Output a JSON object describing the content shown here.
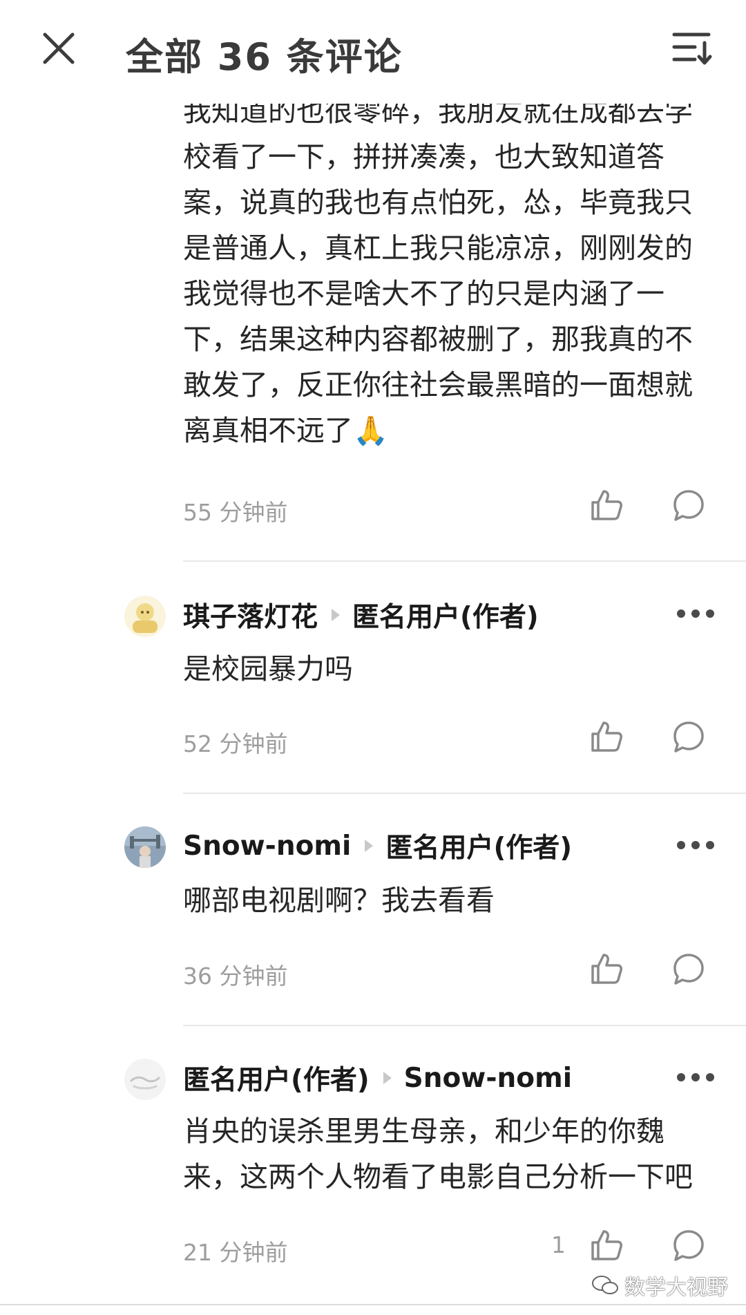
{
  "header": {
    "title": "全部 36 条评论",
    "close_icon": "close-icon",
    "sort_icon": "sort-icon"
  },
  "comments": [
    {
      "body_lines": [
        "我知道的也很零碎，我朋友就在成都去学",
        "校看了一下，拼拼凑凑，也大致知道答",
        "案，说真的我也有点怕死，怂，毕竟我只",
        "是普通人，真杠上我只能凉凉，刚刚发的",
        "我觉得也不是啥大不了的只是内涵了一",
        "下，结果这种内容都被删了，那我真的不",
        "敢发了，反正你往社会最黑暗的一面想就",
        "离真相不远了🙏"
      ],
      "time": "55 分钟前"
    },
    {
      "author": "琪子落灯花",
      "reply_to": "匿名用户(作者)",
      "body_lines": [
        "是校园暴力吗"
      ],
      "time": "52 分钟前"
    },
    {
      "author": "Snow-nomi",
      "reply_to": "匿名用户(作者)",
      "body_lines": [
        "哪部电视剧啊？我去看看"
      ],
      "time": "36 分钟前"
    },
    {
      "author": "匿名用户(作者)",
      "reply_to": "Snow-nomi",
      "body_lines": [
        "肖央的误杀里男生母亲，和少年的你魏",
        "来，这两个人物看了电影自己分析一下吧"
      ],
      "time": "21 分钟前",
      "like_count": "1"
    }
  ],
  "watermark": "数学大视野",
  "colors": {
    "text": "#262626",
    "meta": "#9d9d9d",
    "divider": "#e8e8e8",
    "icon": "#8a8a8a"
  }
}
